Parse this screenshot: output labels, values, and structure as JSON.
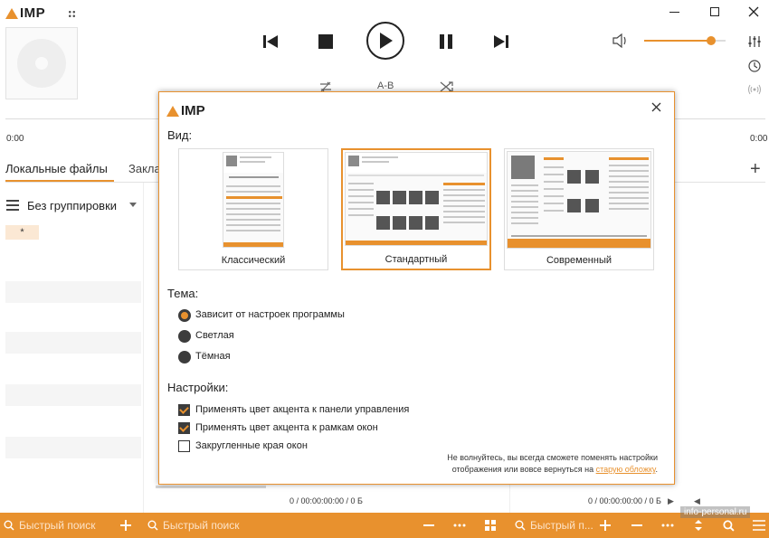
{
  "app": {
    "logo_text": "IMP"
  },
  "player": {
    "time_elapsed": "0:00",
    "time_remaining": "0:00",
    "ab_label": "A-B",
    "volume_level": 0.82
  },
  "tabs": {
    "local_files": "Локальные файлы",
    "bookmarks_partial": "Закла"
  },
  "grouping": {
    "label": "Без группировки",
    "star": "*"
  },
  "playlist": {
    "info_left": "0 / 00:00:00:00 / 0 Б",
    "info_right": "0 / 00:00:00:00 / 0 Б"
  },
  "bottombar": {
    "search1_placeholder": "Быстрый поиск",
    "search2_placeholder": "Быстрый поиск",
    "search3_placeholder": "Быстрый п..."
  },
  "watermark": "info-personal.ru",
  "dialog": {
    "logo_text": "IMP",
    "view_heading": "Вид:",
    "skins": [
      {
        "label": "Классический",
        "selected": false
      },
      {
        "label": "Стандартный",
        "selected": true
      },
      {
        "label": "Современный",
        "selected": false
      }
    ],
    "theme_heading": "Тема:",
    "themes": [
      {
        "label": "Зависит от настроек программы",
        "selected": true
      },
      {
        "label": "Светлая",
        "selected": false
      },
      {
        "label": "Тёмная",
        "selected": false
      }
    ],
    "settings_heading": "Настройки:",
    "settings": [
      {
        "label": "Применять цвет акцента к панели управления",
        "checked": true
      },
      {
        "label": "Применять цвет акцента к рамкам окон",
        "checked": true
      },
      {
        "label": "Закругленные края окон",
        "checked": false
      }
    ],
    "note_line1": "Не волнуйтесь, вы всегда сможете поменять настройки",
    "note_line2": "отображения или вовсе вернуться на",
    "note_link": "старую обложку",
    "note_end": "."
  },
  "colors": {
    "accent": "#e8912e",
    "dark": "#3c3c3c"
  }
}
